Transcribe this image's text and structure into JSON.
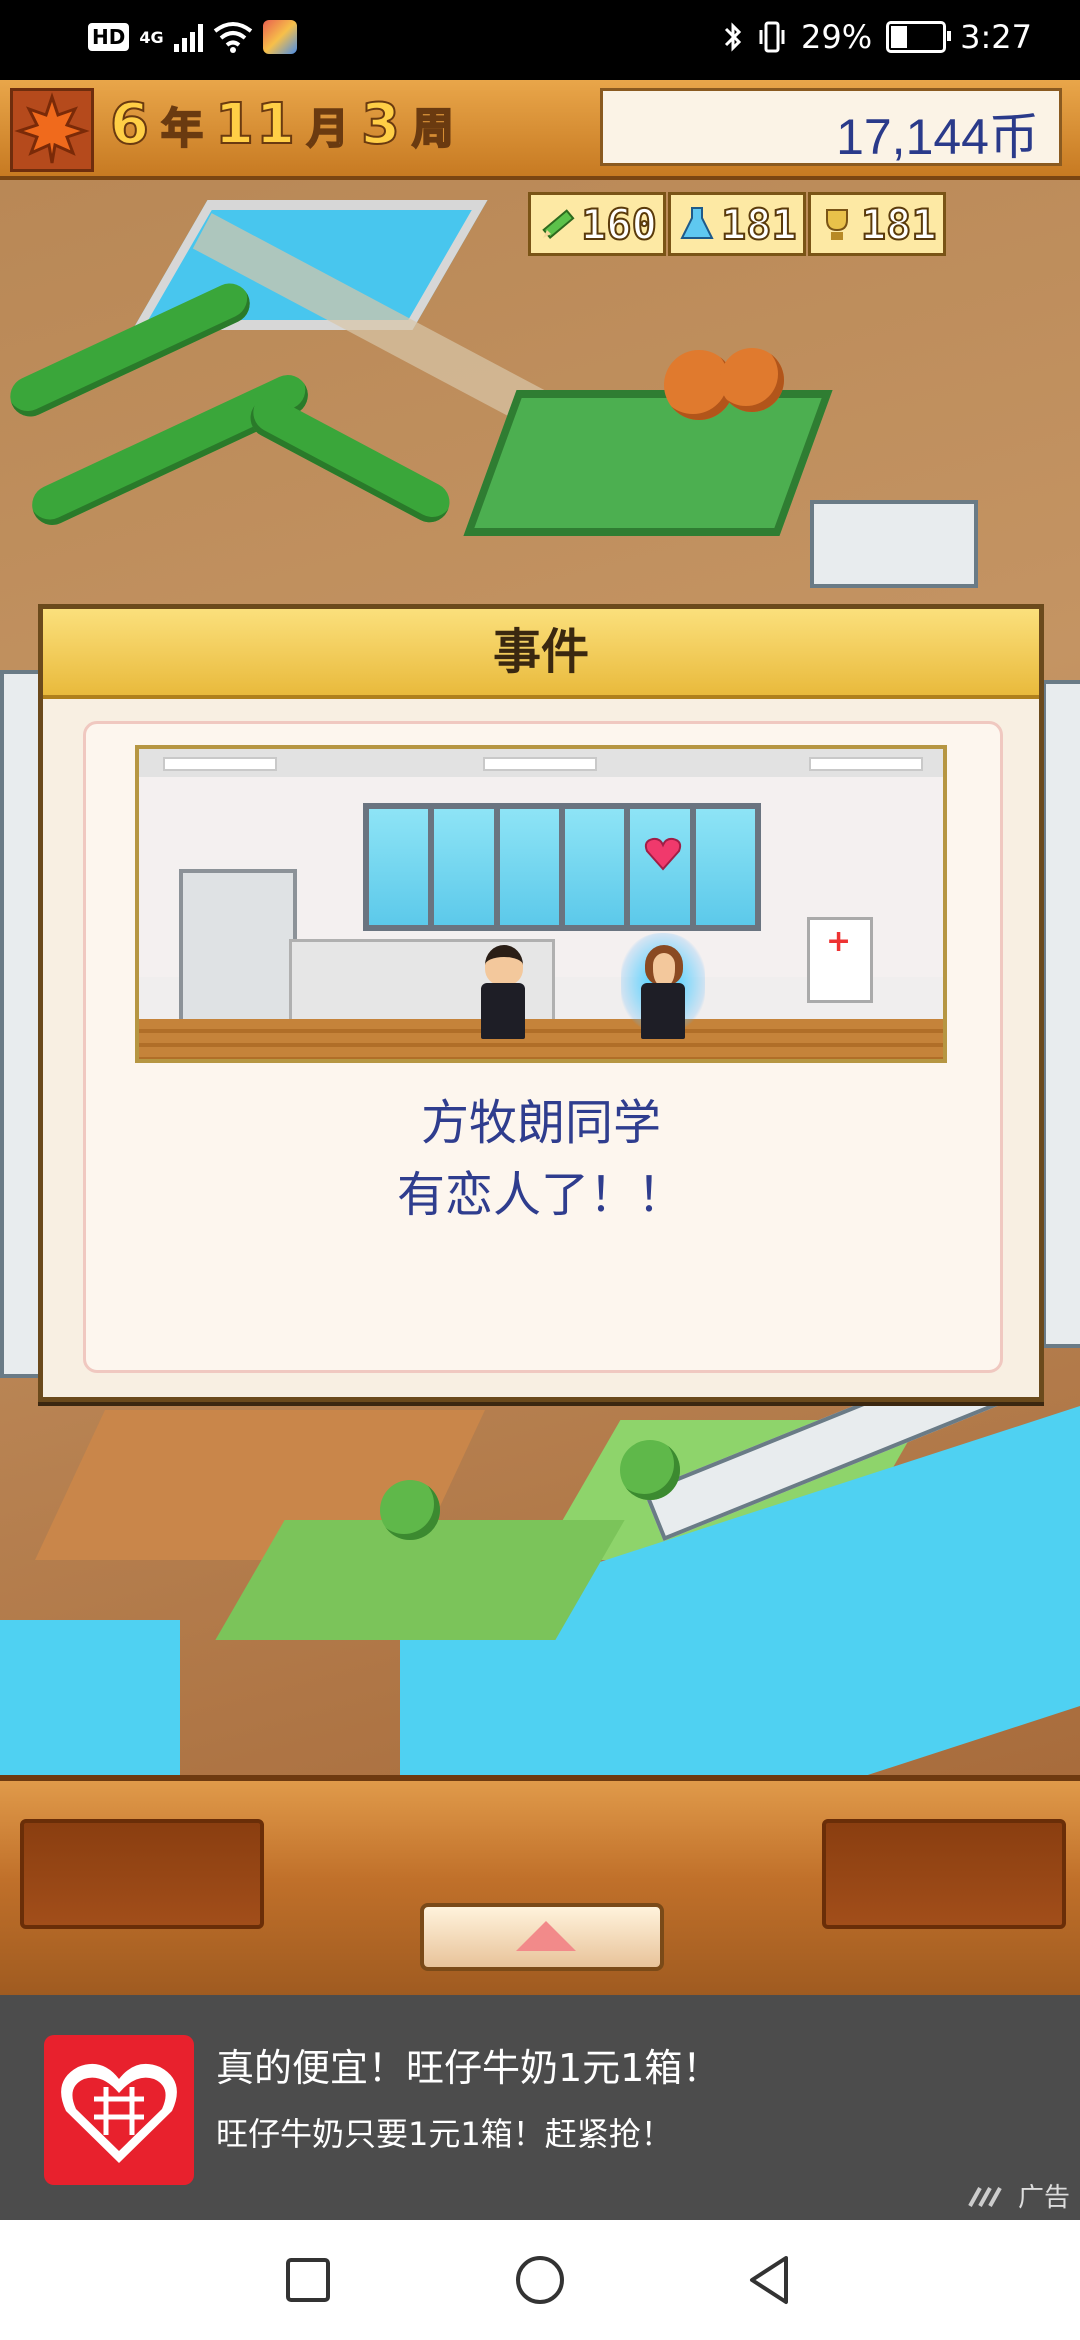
{
  "status_bar": {
    "hd": "HD",
    "network": "4G",
    "battery": "29%",
    "battery_level": 0.29,
    "time": "3:27"
  },
  "game_header": {
    "year": "6",
    "year_unit": "年",
    "month": "11",
    "month_unit": "月",
    "week": "3",
    "week_unit": "周",
    "money": "17,144币"
  },
  "stats": [
    {
      "icon": "pencil-icon",
      "value": "160"
    },
    {
      "icon": "flask-icon",
      "value": "181"
    },
    {
      "icon": "trophy-icon",
      "value": "181"
    }
  ],
  "event": {
    "title": "事件",
    "line1": "方牧朗同学",
    "line2": "有恋人了！！"
  },
  "ad": {
    "title": "真的便宜！旺仔牛奶1元1箱！",
    "description": "旺仔牛奶只要1元1箱！赶紧抢！",
    "tag": "广告"
  },
  "colors": {
    "header_orange": "#e9a64a",
    "money_text": "#2a3a8a",
    "event_text": "#2f3d8e",
    "ad_red": "#e8212d"
  }
}
